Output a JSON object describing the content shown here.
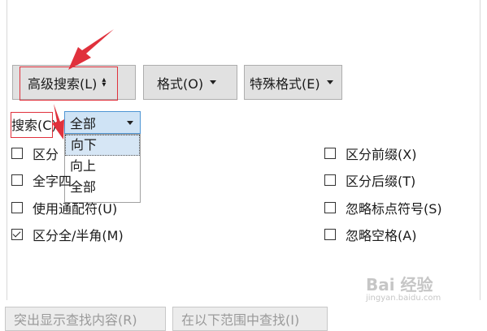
{
  "toolbar": {
    "advanced_search_label": "高级搜索(L)",
    "format_label": "格式(O)",
    "special_format_label": "特殊格式(E)"
  },
  "search": {
    "label": "搜索(C)",
    "selected": "全部",
    "options": [
      "向下",
      "向上",
      "全部"
    ],
    "highlighted_option": "向下"
  },
  "options_left": [
    {
      "label": "区分大小写(H)",
      "visible_label": "区分",
      "checked": false
    },
    {
      "label": "全字匹配(Y)",
      "visible_label": "全字四",
      "checked": false
    },
    {
      "label": "使用通配符(U)",
      "visible_label": "使用通配符(U)",
      "checked": false
    },
    {
      "label": "区分全/半角(M)",
      "visible_label": "区分全/半角(M)",
      "checked": true
    }
  ],
  "options_right": [
    {
      "label": "区分前缀(X)",
      "checked": false
    },
    {
      "label": "区分后缀(T)",
      "checked": false
    },
    {
      "label": "忽略标点符号(S)",
      "checked": false
    },
    {
      "label": "忽略空格(A)",
      "checked": false
    }
  ],
  "bottom_buttons": [
    "突出显示查找内容(R)",
    "在以下范围中查找(I)"
  ],
  "watermark": {
    "text": "Bai 经验",
    "sub": "jingyan.baidu.com"
  },
  "colors": {
    "annotation_red": "#e0313c",
    "select_bg": "#cfe3f5",
    "select_border": "#4e95d4"
  }
}
